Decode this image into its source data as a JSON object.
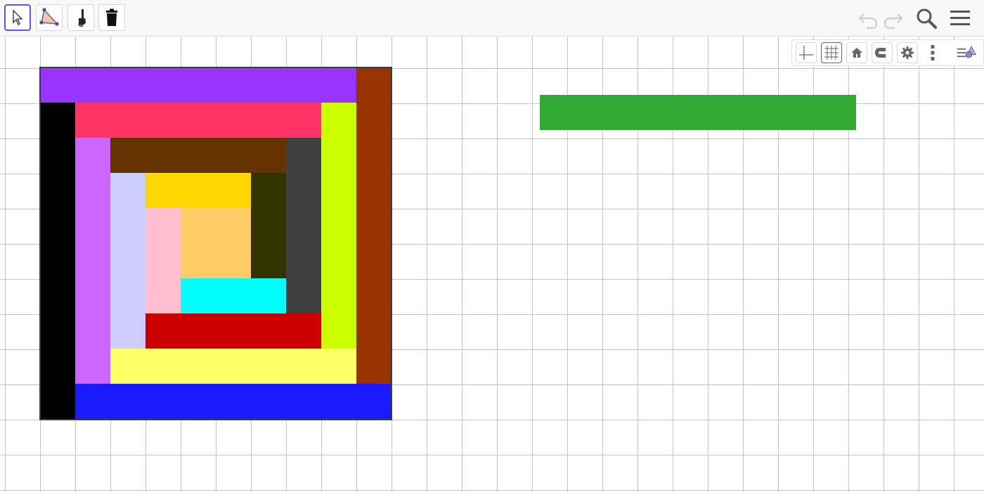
{
  "toolbar": {
    "tools": [
      {
        "name": "move-tool",
        "icon": "pointer-arrow-icon",
        "selected": true
      },
      {
        "name": "polygon-tool",
        "icon": "polygon-icon",
        "selected": false
      },
      {
        "name": "style-tool",
        "icon": "paintbrush-icon",
        "selected": false
      },
      {
        "name": "delete-tool",
        "icon": "trash-icon",
        "selected": false
      }
    ],
    "right_icons": [
      "undo-icon",
      "redo-icon",
      "search-icon",
      "hamburger-menu-icon"
    ]
  },
  "style_bar": {
    "buttons": [
      "axes-toggle-icon",
      "grid-toggle-icon",
      "home-icon",
      "snap-magnet-icon",
      "settings-gear-icon",
      "more-vertical-icon",
      "toggle-style-bar-icon"
    ]
  },
  "canvas": {
    "grid_visible": true,
    "colors": {
      "purple": "#9933ff",
      "brown": "#993300",
      "black": "#000000",
      "pink_red": "#ff3366",
      "lime": "#ccff00",
      "violet": "#cc66ff",
      "dark_brown": "#663300",
      "dark_gray": "#404040",
      "lavender": "#ccccff",
      "gold": "#ffd700",
      "olive_dark": "#333300",
      "light_pink": "#ffbfcc",
      "light_orange": "#ffcc66",
      "cyan": "#00ffff",
      "red": "#cc0000",
      "light_yellow": "#ffff66",
      "blue": "#1a1aff",
      "green": "#33aa33"
    }
  }
}
